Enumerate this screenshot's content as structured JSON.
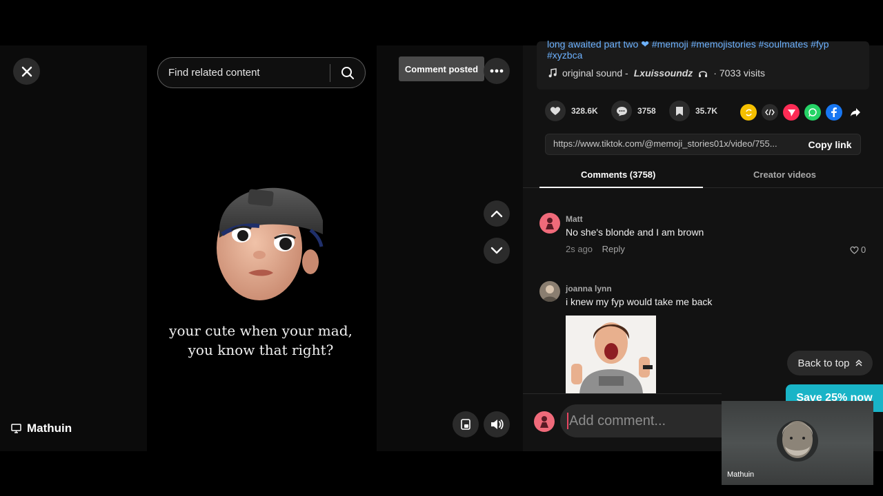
{
  "presenter": {
    "name": "Mathuin"
  },
  "search": {
    "placeholder": "Find related content"
  },
  "video": {
    "caption_line1": "your cute when your mad,",
    "caption_line2": "you know that right?"
  },
  "toast": {
    "text": "Comment posted"
  },
  "description": {
    "line1": "long awaited part two ❤ #memoji #memojistories #soulmates #fyp",
    "line2": "#xyzbca",
    "sound_label": "original sound -",
    "sound_author": "Lxuissoundz",
    "visits": "· 7033 visits"
  },
  "stats": {
    "likes": "328.6K",
    "comments": "3758",
    "saves": "35.7K"
  },
  "link": {
    "url": "https://www.tiktok.com/@memoji_stories01x/video/755...",
    "copy_label": "Copy link"
  },
  "tabs": {
    "comments": "Comments (3758)",
    "creator": "Creator videos"
  },
  "comments": [
    {
      "user": "Matt",
      "text": "No she's blonde and I am brown",
      "time": "2s ago",
      "reply": "Reply",
      "likes": "0"
    },
    {
      "user": "joanna lynn",
      "text": "i knew my fyp would take me back"
    }
  ],
  "back_to_top": "Back to top",
  "promo": "Save 25% now",
  "add_comment": {
    "placeholder": "Add comment..."
  },
  "camera": {
    "name": "Mathuin"
  },
  "colors": {
    "accent": "#fe2c55",
    "promo": "#19b4c7",
    "link": "#6db2ff"
  },
  "icons": [
    "close-icon",
    "search-icon",
    "more-icon",
    "chevron-up-icon",
    "chevron-down-icon",
    "pip-icon",
    "volume-icon",
    "heart-icon",
    "comment-icon",
    "bookmark-icon",
    "music-icon",
    "share-icon"
  ]
}
